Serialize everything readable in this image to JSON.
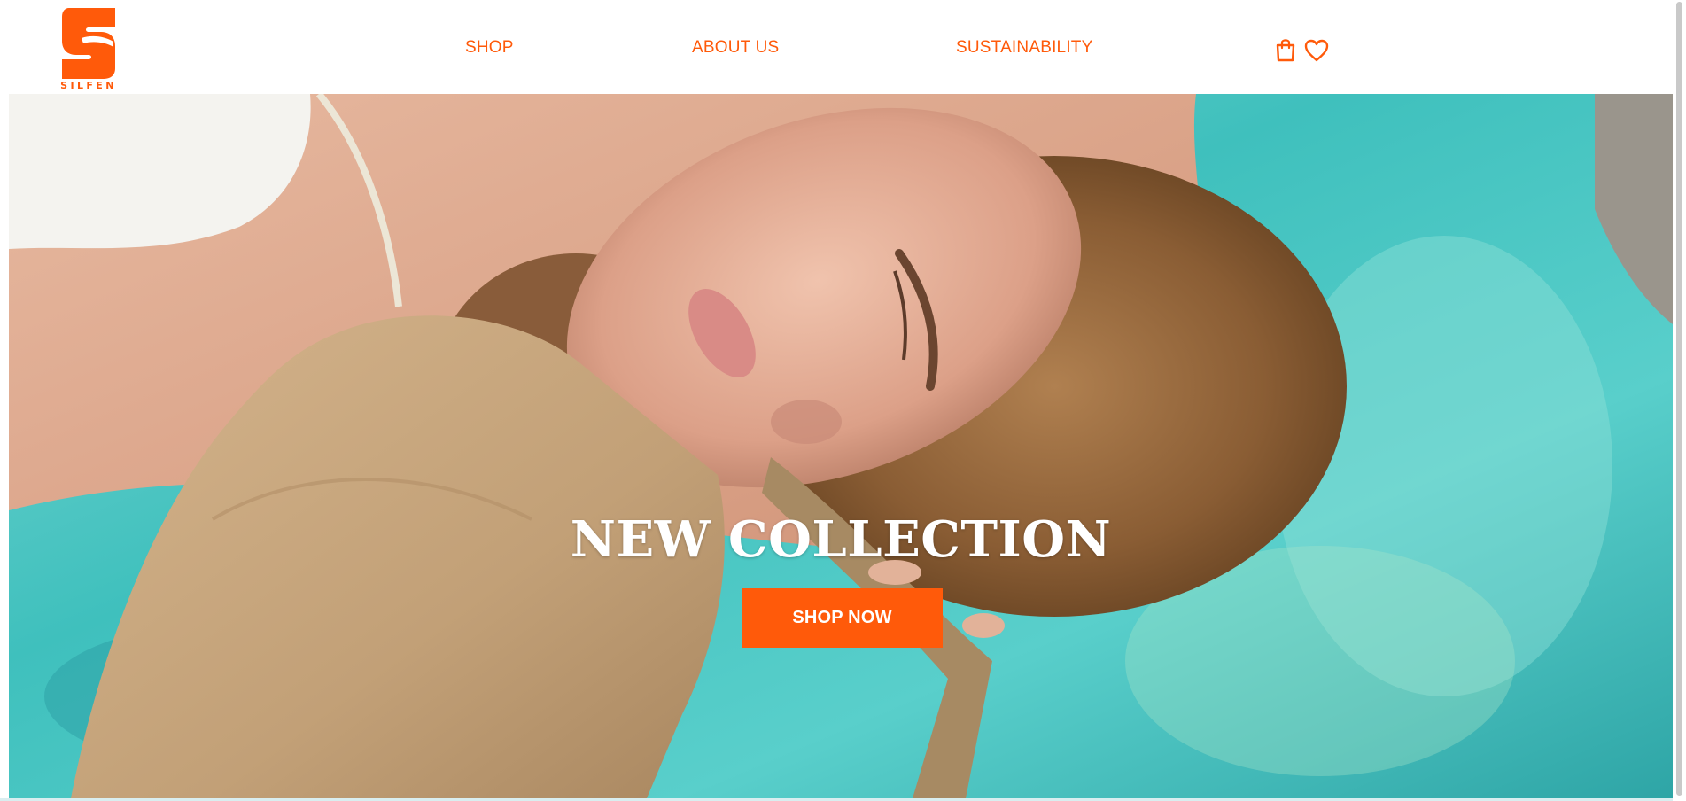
{
  "brand": {
    "name": "SILFEN",
    "accent_color": "#ff5a0a",
    "logo_icon": "silfen-s-logo"
  },
  "nav": {
    "items": [
      {
        "label": "SHOP"
      },
      {
        "label": "ABOUT US"
      },
      {
        "label": "SUSTAINABILITY"
      }
    ],
    "icons": [
      "shopping-bag-icon",
      "heart-icon"
    ]
  },
  "hero": {
    "title": "NEW COLLECTION",
    "cta_label": "SHOP NOW",
    "cta_color": "#ff5a0a",
    "image_subject": "hero-photo"
  }
}
